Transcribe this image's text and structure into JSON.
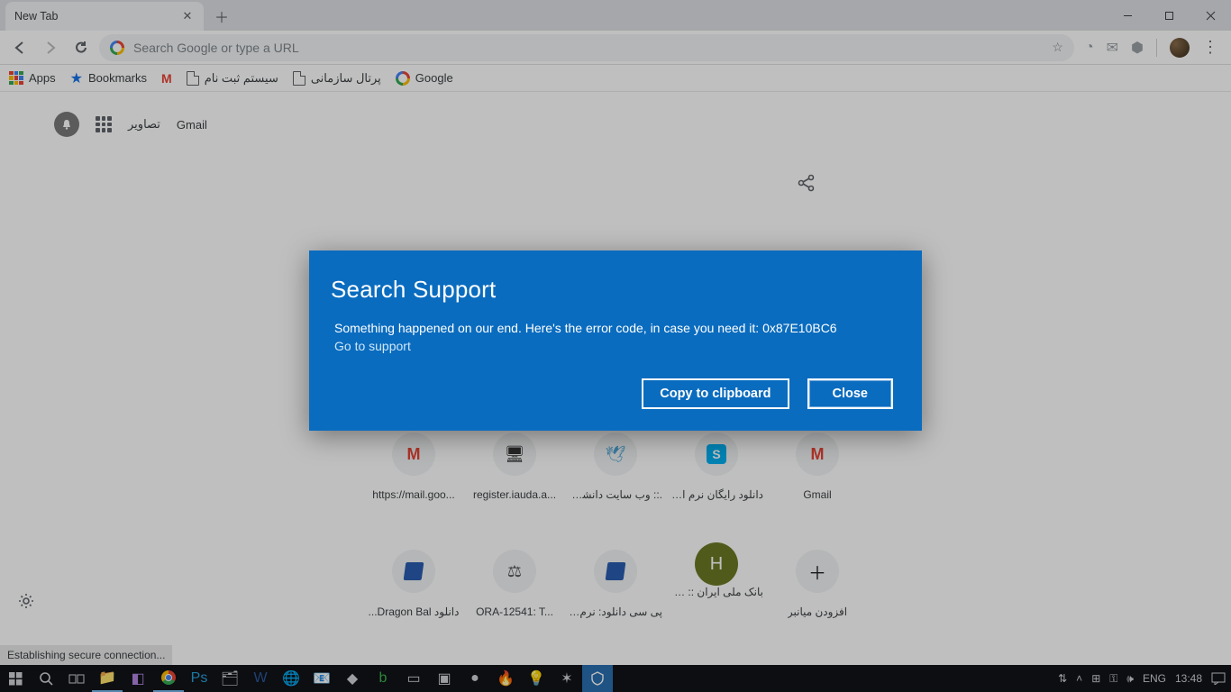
{
  "tab": {
    "title": "New Tab"
  },
  "window_controls": {
    "minimize": "min",
    "maximize": "max",
    "close": "close"
  },
  "toolbar": {
    "omnibox_placeholder": "Search Google or type a URL"
  },
  "bookmarks": {
    "apps": "Apps",
    "bookmarks": "Bookmarks",
    "item3": "سیستم ثبت نام",
    "item4": "پرتال سازمانی",
    "item5": "Google"
  },
  "ntp": {
    "gmail_link": "Gmail",
    "images_link": "تصاویر"
  },
  "shortcuts": [
    {
      "label": "https://mail.goo...",
      "ltr": true,
      "icon": "gmail"
    },
    {
      "label": "register.iauda.a...",
      "ltr": true,
      "icon": "pc"
    },
    {
      "label": ".:: وب سایت دانشگاه ...",
      "icon": "bird"
    },
    {
      "label": "دانلود رایگان نرم افزار",
      "icon": "skype"
    },
    {
      "label": "Gmail",
      "ltr": true,
      "icon": "gmail"
    },
    {
      "label": "دانلود Dragon Bal...",
      "icon": "doc"
    },
    {
      "label": "ORA-12541: T...",
      "ltr": true,
      "icon": "scales"
    },
    {
      "label": "پی سی دانلود: نرم افز...",
      "icon": "doc"
    },
    {
      "label": "بانک ملی ایران :: شب...",
      "icon": "h"
    },
    {
      "label": "افزودن میانبر",
      "icon": "add"
    }
  ],
  "status_text": "Establishing secure connection...",
  "modal": {
    "title": "Search Support",
    "message": "Something happened on our end. Here's the error code, in case you need it: 0x87E10BC6",
    "link": "Go to support",
    "copy_btn": "Copy to clipboard",
    "close_btn": "Close"
  },
  "taskbar": {
    "lang": "ENG",
    "time": "13:48"
  }
}
